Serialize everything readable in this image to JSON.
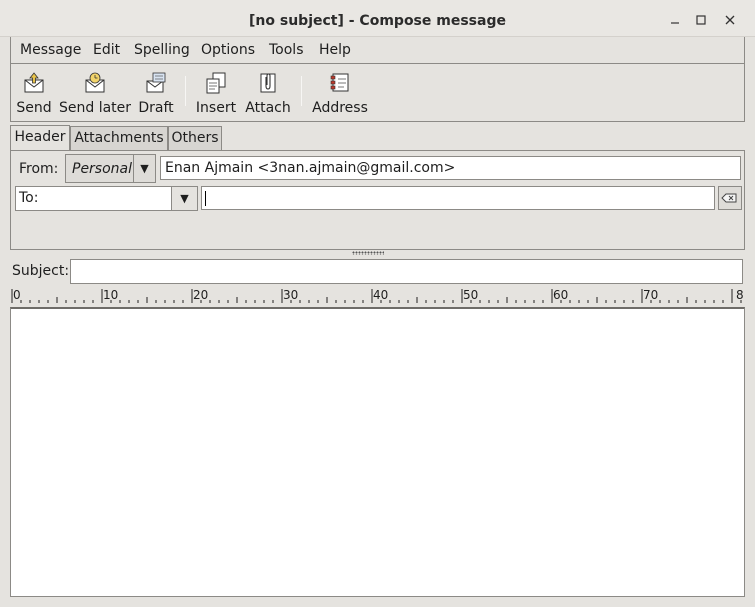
{
  "window": {
    "title": "[no subject] - Compose message",
    "controls": [
      "minimize",
      "maximize",
      "close"
    ]
  },
  "menubar": {
    "items": [
      "Message",
      "Edit",
      "Spelling",
      "Options",
      "Tools",
      "Help"
    ]
  },
  "toolbar": {
    "send": "Send",
    "send_later": "Send later",
    "draft": "Draft",
    "insert": "Insert",
    "attach": "Attach",
    "address": "Address"
  },
  "tabs": [
    "Header",
    "Attachments",
    "Others"
  ],
  "header": {
    "from_label": "From:",
    "from_account": "Personal",
    "from_value": "Enan Ajmain <3nan.ajmain@gmail.com>",
    "recipient_type": "To:",
    "recipient_value": ""
  },
  "subject": {
    "label": "Subject:",
    "value": ""
  },
  "ruler": {
    "labels": [
      "0",
      "10",
      "20",
      "30",
      "40",
      "50",
      "60",
      "70",
      "8"
    ]
  },
  "editor": {
    "body": ""
  }
}
